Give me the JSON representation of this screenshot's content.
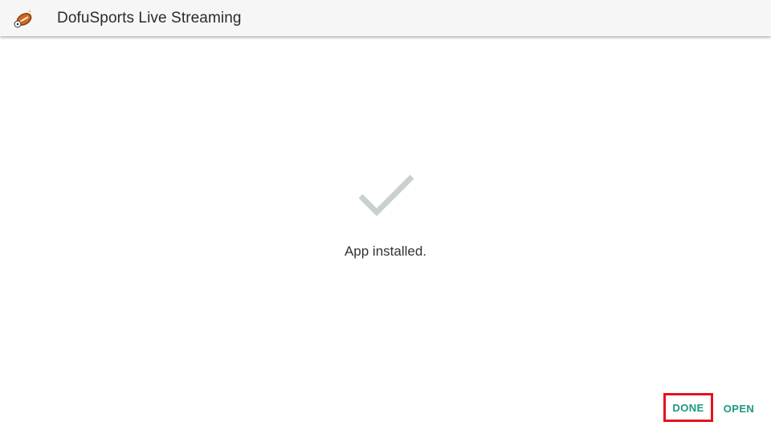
{
  "header": {
    "title": "DofuSports Live Streaming",
    "icon": "football-app-icon"
  },
  "status": {
    "icon": "checkmark-icon",
    "message": "App installed."
  },
  "actions": {
    "done_label": "DONE",
    "open_label": "OPEN"
  },
  "colors": {
    "accent": "#1a9a7e",
    "highlight_border": "#e3141f",
    "check": "#c9d1cf",
    "header_bg": "#f6f6f6"
  }
}
